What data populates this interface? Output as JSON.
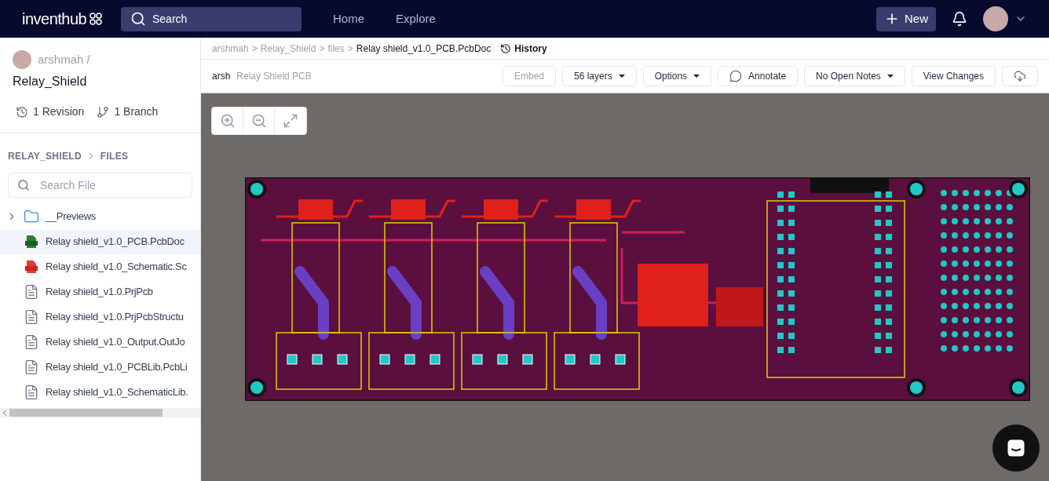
{
  "nav": {
    "logo": "inventhub",
    "search": {
      "placeholder": "Search"
    },
    "links": [
      "Home",
      "Explore"
    ],
    "new_button": "New"
  },
  "sidebar": {
    "owner": "arshmah /",
    "repo": "Relay_Shield",
    "stats": [
      {
        "kind": "revision",
        "label": "1 Revision"
      },
      {
        "kind": "branch",
        "label": "1 Branch"
      }
    ],
    "path": [
      "RELAY_SHIELD",
      "FILES"
    ],
    "search": {
      "placeholder": "Search File"
    },
    "files": [
      {
        "kind": "folder",
        "name": "__Previews",
        "expanded": false,
        "selected": false
      },
      {
        "kind": "pcb",
        "name": "Relay shield_v1.0_PCB.PcbDoc",
        "selected": true
      },
      {
        "kind": "sch",
        "name": "Relay shield_v1.0_Schematic.Sc",
        "selected": false
      },
      {
        "kind": "doc",
        "name": "Relay shield_v1.0.PrjPcb",
        "selected": false
      },
      {
        "kind": "doc",
        "name": "Relay shield_v1.0.PrjPcbStructu",
        "selected": false
      },
      {
        "kind": "doc",
        "name": "Relay shield_v1.0_Output.OutJo",
        "selected": false
      },
      {
        "kind": "doc",
        "name": "Relay shield_v1.0_PCBLib.PcbLi",
        "selected": false
      },
      {
        "kind": "doc",
        "name": "Relay shield_v1.0_SchematicLib.",
        "selected": false
      }
    ]
  },
  "breadcrumb": [
    {
      "label": "arshmah",
      "separator": ">"
    },
    {
      "label": "Relay_Shield",
      "separator": ">"
    },
    {
      "label": "files",
      "separator": ">"
    }
  ],
  "current_file": "Relay shield_v1.0_PCB.PcbDoc",
  "history": "History",
  "toolbar": {
    "user": "arsh",
    "title": "Relay Shield PCB",
    "buttons": [
      {
        "kind": "plain",
        "label": "Embed",
        "disabled": true
      },
      {
        "kind": "dropdown",
        "label": "56 layers",
        "disabled": false
      },
      {
        "kind": "dropdown",
        "label": "Options",
        "disabled": false
      },
      {
        "kind": "annotate",
        "label": "Annotate",
        "disabled": false
      },
      {
        "kind": "dropdown",
        "label": "No Open Notes",
        "disabled": false
      },
      {
        "kind": "plain",
        "label": "View Changes",
        "disabled": false
      },
      {
        "kind": "download",
        "disabled": false
      }
    ]
  }
}
